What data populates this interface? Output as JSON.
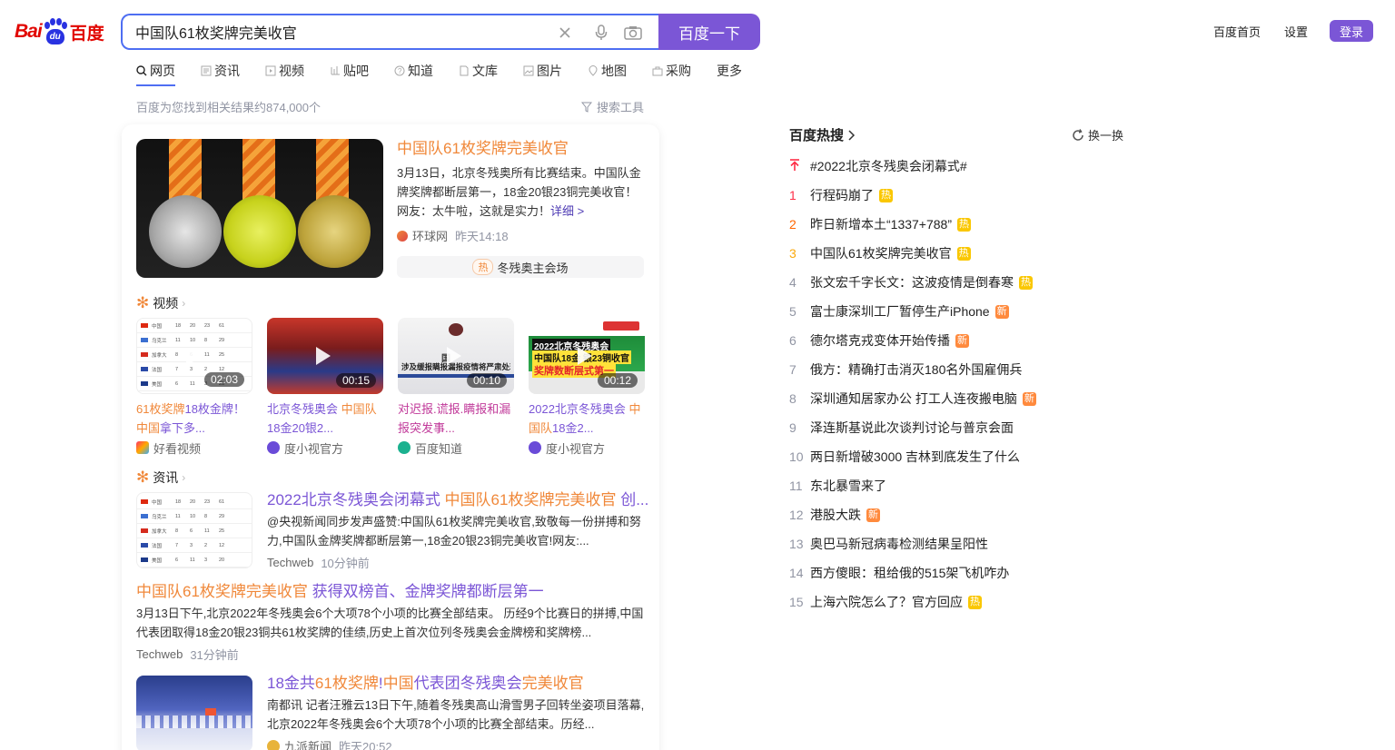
{
  "logo": {
    "left": "Bai",
    "mid": "du",
    "right": "百度"
  },
  "search": {
    "query": "中国队61枚奖牌完美收官",
    "button_label": "百度一下"
  },
  "top_links": {
    "home": "百度首页",
    "settings": "设置",
    "login": "登录"
  },
  "tabs": [
    {
      "label": "网页",
      "icon": "search-icon"
    },
    {
      "label": "资讯",
      "icon": "news-icon"
    },
    {
      "label": "视频",
      "icon": "video-icon"
    },
    {
      "label": "贴吧",
      "icon": "tieba-icon"
    },
    {
      "label": "知道",
      "icon": "question-icon"
    },
    {
      "label": "文库",
      "icon": "doc-icon"
    },
    {
      "label": "图片",
      "icon": "image-icon"
    },
    {
      "label": "地图",
      "icon": "map-icon"
    },
    {
      "label": "采购",
      "icon": "shop-icon"
    },
    {
      "label": "更多",
      "icon": ""
    }
  ],
  "result_count": "百度为您找到相关结果约874,000个",
  "search_tools": "搜索工具",
  "top_result": {
    "title": "中国队61枚奖牌完美收官",
    "abstract": "3月13日，北京冬残奥所有比赛结束。中国队金牌奖牌都断层第一，18金20银23铜完美收官！网友：太牛啦，这就是实力！",
    "more": "详细 >",
    "source": "环球网",
    "time": "昨天14:18",
    "chip_tag": "热",
    "chip_label": "冬残奥主会场"
  },
  "video_section": {
    "heading": "视频",
    "items": [
      {
        "title_hl": "61枚奖牌",
        "title_rest": "18枚金牌！",
        "title_hl2": "中国",
        "title_rest2": "拿下多...",
        "duration": "02:03",
        "source": "好看视频"
      },
      {
        "title_rest": "北京冬残奥会 ",
        "title_hl": "中国队",
        "title_rest2": "18金20银2...",
        "duration": "00:15",
        "source": "度小视官方"
      },
      {
        "title_rest": "对迟报.谎报.瞒报和漏报突发事...",
        "duration": "00:10",
        "source": "百度知道",
        "thumb_text1": "国",
        "thumb_text2": "涉及缓报瞒报漏报疫情将严肃处理"
      },
      {
        "title_rest": "2022北京冬残奥会 ",
        "title_hl": "中国队",
        "title_rest2": "18金2...",
        "duration": "00:12",
        "source": "度小视官方",
        "thumb_line1": "2022北京冬残奥会",
        "thumb_line2": "中国队18金   银23铜收官",
        "thumb_line3": "奖牌数断层式第一"
      }
    ]
  },
  "news_section": {
    "heading": "资讯",
    "items": [
      {
        "title_a": "2022北京冬残奥会闭幕式 ",
        "title_hl": "中国队61枚奖牌完美收官",
        "title_b": " 创...",
        "abstract": "@央视新闻同步发声盛赞:中国队61枚奖牌完美收官,致敬每一份拼搏和努力,中国队金牌奖牌都断层第一,18金20银23铜完美收官!网友:...",
        "source": "Techweb",
        "time": "10分钟前"
      },
      {
        "title_hl": "中国队61枚奖牌完美收官",
        "title_b": " 获得双榜首、金牌奖牌都断层第一",
        "abstract": "3月13日下午,北京2022年冬残奥会6个大项78个小项的比赛全部结束。 历经9个比赛日的拼搏,中国代表团取得18金20银23铜共61枚奖牌的佳绩,历史上首次位列冬残奥会金牌榜和奖牌榜...",
        "source": "Techweb",
        "time": "31分钟前"
      },
      {
        "parts": [
          "18金共",
          "61枚奖牌",
          "!",
          "中国",
          "代表团冬残奥会",
          "完美收官"
        ],
        "abstract": "南都讯 记者汪雅云13日下午,随着冬残奥高山滑雪男子回转坐姿项目落幕,北京2022年冬残奥会6个大项78个小项的比赛全部结束。历经...",
        "source": "九派新闻",
        "time": "昨天20:52"
      }
    ]
  },
  "medal_table": {
    "rows": [
      {
        "country": "中国",
        "g": "18",
        "s": "20",
        "b": "23",
        "t": "61"
      },
      {
        "country": "乌克兰",
        "g": "11",
        "s": "10",
        "b": "8",
        "t": "29"
      },
      {
        "country": "加拿大",
        "g": "8",
        "s": "6",
        "b": "11",
        "t": "25"
      },
      {
        "country": "法国",
        "g": "7",
        "s": "3",
        "b": "2",
        "t": "12"
      },
      {
        "country": "美国",
        "g": "6",
        "s": "11",
        "b": "3",
        "t": "20"
      }
    ]
  },
  "hot_search": {
    "heading": "百度热搜",
    "refresh": "换一换",
    "items": [
      {
        "idx": "",
        "text": "#2022北京冬残奥会闭幕式#",
        "tag": ""
      },
      {
        "idx": "1",
        "text": "行程码崩了",
        "tag": "热"
      },
      {
        "idx": "2",
        "text": "昨日新增本土“1337+788”",
        "tag": "热"
      },
      {
        "idx": "3",
        "text": "中国队61枚奖牌完美收官",
        "tag": "热"
      },
      {
        "idx": "4",
        "text": "张文宏千字长文：这波疫情是倒春寒",
        "tag": "热"
      },
      {
        "idx": "5",
        "text": "富士康深圳工厂暂停生产iPhone",
        "tag": "新"
      },
      {
        "idx": "6",
        "text": "德尔塔克戎变体开始传播",
        "tag": "新"
      },
      {
        "idx": "7",
        "text": "俄方：精确打击消灭180名外国雇佣兵",
        "tag": ""
      },
      {
        "idx": "8",
        "text": "深圳通知居家办公 打工人连夜搬电脑",
        "tag": "新"
      },
      {
        "idx": "9",
        "text": "泽连斯基说此次谈判讨论与普京会面",
        "tag": ""
      },
      {
        "idx": "10",
        "text": "两日新增破3000 吉林到底发生了什么",
        "tag": ""
      },
      {
        "idx": "11",
        "text": "东北暴雪来了",
        "tag": ""
      },
      {
        "idx": "12",
        "text": "港股大跌",
        "tag": "新"
      },
      {
        "idx": "13",
        "text": "奥巴马新冠病毒检测结果呈阳性",
        "tag": ""
      },
      {
        "idx": "14",
        "text": "西方傻眼：租给俄的515架飞机咋办",
        "tag": ""
      },
      {
        "idx": "15",
        "text": "上海六院怎么了？官方回应",
        "tag": "热"
      }
    ]
  },
  "colors": {
    "brand": "#7b56d6",
    "accent": "#4e6ef2",
    "highlight": "#f0883a"
  }
}
